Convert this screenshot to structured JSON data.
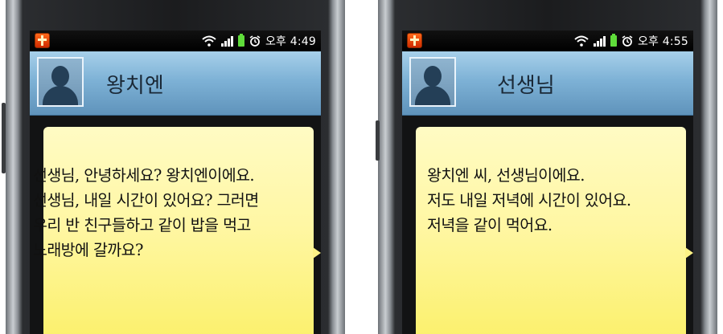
{
  "screens": [
    {
      "status": {
        "time": "오후 4:49",
        "icons": [
          "app-bible-icon",
          "wifi-icon",
          "signal-icon",
          "battery-icon",
          "alarm-icon"
        ]
      },
      "contact": {
        "name": "왕치엔"
      },
      "message": {
        "lines": [
          "선생님, 안녕하세요? 왕치엔이에요.",
          "선생님, 내일 시간이 있어요? 그러면",
          "우리 반 친구들하고 같이 밥을 먹고",
          "노래방에 갈까요?"
        ]
      }
    },
    {
      "status": {
        "time": "오후 4:55",
        "icons": [
          "app-bible-icon",
          "wifi-icon",
          "signal-icon",
          "battery-icon",
          "alarm-icon"
        ]
      },
      "contact": {
        "name": "선생님"
      },
      "message": {
        "lines": [
          "왕치엔 씨, 선생님이에요.",
          "저도 내일 저녁에 시간이 있어요.",
          "저녁을 같이 먹어요."
        ]
      }
    }
  ],
  "colors": {
    "header": "#7eb2d6",
    "note": "#fff7a4",
    "battery": "#5fdc3a",
    "app_icon": "#e84a10"
  }
}
